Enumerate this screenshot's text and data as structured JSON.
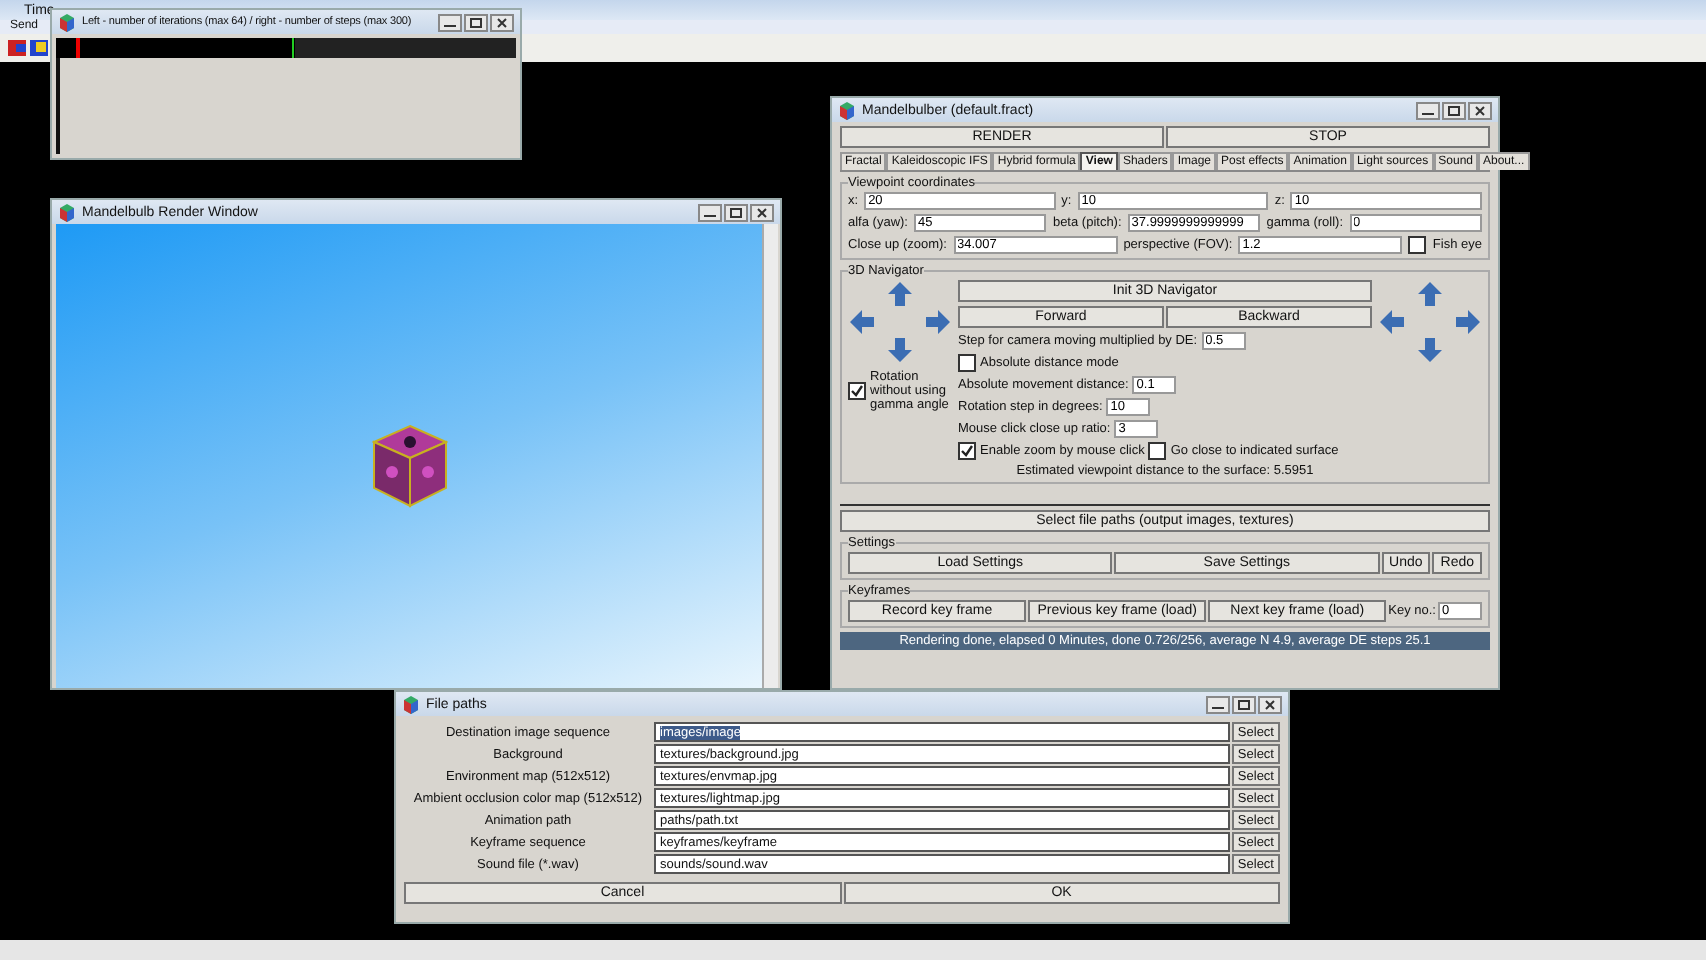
{
  "desktop": {
    "app_title": "Time",
    "menu": [
      "Send"
    ]
  },
  "progress_window": {
    "title": "Left - number of iterations (max 64) / right - number of steps (max 300)"
  },
  "render_window": {
    "title": "Mandelbulb Render Window"
  },
  "main_window": {
    "title": "Mandelbulber (default.fract)",
    "actions": [
      "RENDER",
      "STOP"
    ],
    "tabs": [
      {
        "label": "Fractal",
        "selected": false
      },
      {
        "label": "Kaleidoscopic IFS",
        "selected": false
      },
      {
        "label": "Hybrid formula",
        "selected": false
      },
      {
        "label": "View",
        "selected": true
      },
      {
        "label": "Shaders",
        "selected": false
      },
      {
        "label": "Image",
        "selected": false
      },
      {
        "label": "Post effects",
        "selected": false
      },
      {
        "label": "Animation",
        "selected": false
      },
      {
        "label": "Light sources",
        "selected": false
      },
      {
        "label": "Sound",
        "selected": false
      },
      {
        "label": "About...",
        "selected": false
      }
    ],
    "viewpoint": {
      "title": "Viewpoint coordinates",
      "rows": [
        [
          {
            "kind": "field",
            "label": "x:",
            "value": "20"
          },
          {
            "kind": "field",
            "label": "y:",
            "value": "10"
          },
          {
            "kind": "field",
            "label": "z:",
            "value": "10"
          }
        ],
        [
          {
            "kind": "field",
            "label": "alfa (yaw):",
            "value": "45"
          },
          {
            "kind": "field",
            "label": "beta (pitch):",
            "value": "37.9999999999999"
          },
          {
            "kind": "field",
            "label": "gamma (roll):",
            "value": "0"
          }
        ],
        [
          {
            "kind": "field",
            "label": "Close up (zoom):",
            "value": "34.007"
          },
          {
            "kind": "field",
            "label": "perspective (FOV):",
            "value": "1.2"
          },
          {
            "kind": "checkbox",
            "label": "Fish eye",
            "checked": false
          }
        ]
      ]
    },
    "navigator": {
      "title": "3D Navigator",
      "init_button": "Init 3D Navigator",
      "move_buttons": [
        "Forward",
        "Backward"
      ],
      "rotation_option": {
        "label": "Rotation without using gamma angle",
        "checked": true
      },
      "rows": [
        [
          {
            "kind": "field",
            "label": "Step for camera moving multiplied by DE:",
            "value": "0.5"
          }
        ],
        [
          {
            "kind": "checkbox",
            "label": "Absolute distance mode",
            "checked": false
          }
        ],
        [
          {
            "kind": "field",
            "label": "Absolute movement distance:",
            "value": "0.1"
          }
        ],
        [
          {
            "kind": "field",
            "label": "Rotation step in degrees:",
            "value": "10"
          }
        ],
        [
          {
            "kind": "field",
            "label": "Mouse click close up ratio:",
            "value": "3"
          }
        ],
        [
          {
            "kind": "checkbox",
            "label": "Enable zoom by mouse click",
            "checked": true
          },
          {
            "kind": "checkbox",
            "label": "Go close to indicated surface",
            "checked": false
          }
        ]
      ],
      "distance_text": "Estimated viewpoint distance to the surface: 5.5951"
    },
    "file_paths_button": "Select file paths (output images, textures)",
    "settings": {
      "title": "Settings",
      "buttons": [
        "Load Settings",
        "Save Settings",
        "Undo",
        "Redo"
      ]
    },
    "keyframes": {
      "title": "Keyframes",
      "buttons": [
        "Record key frame",
        "Previous key frame (load)",
        "Next key frame (load)"
      ],
      "key_label": "Key no.:",
      "key_value": "0"
    },
    "status": "Rendering done, elapsed 0 Minutes, done 0.726/256, average N 4.9, average DE steps 25.1"
  },
  "file_paths_window": {
    "title": "File paths",
    "rows": [
      {
        "label": "Destination image sequence",
        "value": "images/image",
        "selected": true,
        "button": "Select"
      },
      {
        "label": "Background",
        "value": "textures/background.jpg",
        "selected": false,
        "button": "Select"
      },
      {
        "label": "Environment map (512x512)",
        "value": "textures/envmap.jpg",
        "selected": false,
        "button": "Select"
      },
      {
        "label": "Ambient occlusion color map (512x512)",
        "value": "textures/lightmap.jpg",
        "selected": false,
        "button": "Select"
      },
      {
        "label": "Animation path",
        "value": "paths/path.txt",
        "selected": false,
        "button": "Select"
      },
      {
        "label": "Keyframe sequence",
        "value": "keyframes/keyframe",
        "selected": false,
        "button": "Select"
      },
      {
        "label": "Sound file (*.wav)",
        "value": "sounds/sound.wav",
        "selected": false,
        "button": "Select"
      }
    ],
    "buttons": [
      "Cancel",
      "OK"
    ]
  }
}
